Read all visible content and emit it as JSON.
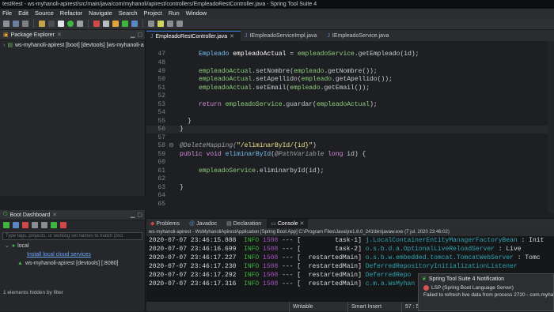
{
  "window_title": "testRest - ws-myhanoli-apirest/src/main/java/com/myhanoli/apirest/controllers/EmpleadoRestController.java - Spring Tool Suite 4",
  "menu": [
    "File",
    "Edit",
    "Source",
    "Refactor",
    "Navigate",
    "Search",
    "Project",
    "Run",
    "Window"
  ],
  "package_explorer": {
    "title": "Package Explorer",
    "project": "ws-myhanoli-apirest [boot] [devtools] [ws-myhanoli-a"
  },
  "boot_dashboard": {
    "title": "Boot Dashboard",
    "search_placeholder": "Type tags, projects, or working set names to match (incl",
    "group": "local",
    "link": "Install local cloud services",
    "app": "ws-myhanoli-apirest [devtools] [:8080]",
    "footer": "1 elements hidden by filter"
  },
  "editor_tabs": [
    "EmpleadoRestController.java",
    "IEmpleadoServiceImpl.java",
    "IEmpleadoService.java"
  ],
  "editor": {
    "line_numbers": [
      "47",
      "48",
      "49",
      "50",
      "51",
      "52",
      "53",
      "54",
      "55",
      "56",
      "57",
      "58",
      "59",
      "60",
      "61",
      "62",
      "63",
      "64",
      "65"
    ],
    "l47": {
      "a": "Empleado ",
      "b": "empleadoActual",
      "c": " = ",
      "d": "empleadoService",
      "e": ".getEmpleado(id);"
    },
    "l49": {
      "a": "empleadoActual",
      "b": ".setNombre(",
      "c": "empleado",
      "d": ".getNombre());"
    },
    "l50": {
      "a": "empleadoActual",
      "b": ".setApellido(",
      "c": "empleado",
      "d": ".getApellido());"
    },
    "l51": {
      "a": "empleadoActual",
      "b": ".setEmail(",
      "c": "empleado",
      "d": ".getEmail());"
    },
    "l53": {
      "a": "return ",
      "b": "empleadoService",
      "c": ".guardar(",
      "d": "empleadoActual",
      "e": ");"
    },
    "l55": "}",
    "l56": "}",
    "l58": {
      "a": "@DeleteMapping(",
      "b": "\"/eliminarById/{id}\"",
      "c": ")"
    },
    "l59": {
      "a": "public void ",
      "b": "eliminarById",
      "c": "(",
      "d": "@PathVariable ",
      "e": "long ",
      "f": "id) {"
    },
    "l61": {
      "a": "empleadoService",
      "b": ".eliminarbyId(id);"
    },
    "l63": "}"
  },
  "console_tabs": [
    "Problems",
    "Javadoc",
    "Declaration",
    "Console"
  ],
  "console_path": "ws-myhanoli-apirest - WsMyhanoliApirestApplication [Spring Boot App] C:\\Program Files\\Java\\jre1.8.0_241\\bin\\javaw.exe (7 jul. 2020 23:46:02)",
  "console_lines": [
    {
      "time": "2020-07-07 23:46:15.888",
      "level": "INFO",
      "pid": "1508",
      "sep": "--- [",
      "thread": "         task-1]",
      "cls": "j.LocalContainerEntityManagerFactoryBean",
      "msg": ": Init"
    },
    {
      "time": "2020-07-07 23:46:16.699",
      "level": "INFO",
      "pid": "1508",
      "sep": "--- [",
      "thread": "         task-2]",
      "cls": "o.s.b.d.a.OptionalLiveReloadServer",
      "msg": ": Live"
    },
    {
      "time": "2020-07-07 23:46:17.227",
      "level": "INFO",
      "pid": "1508",
      "sep": "--- [",
      "thread": "  restartedMain]",
      "cls": "o.s.b.w.embedded.tomcat.TomcatWebServer",
      "msg": ": Tomc"
    },
    {
      "time": "2020-07-07 23:46:17.230",
      "level": "INFO",
      "pid": "1508",
      "sep": "--- [",
      "thread": "  restartedMain]",
      "cls": "DeferredRepositoryInitializationListener",
      "msg": ""
    },
    {
      "time": "2020-07-07 23:46:17.292",
      "level": "INFO",
      "pid": "1508",
      "sep": "--- [",
      "thread": "  restartedMain]",
      "cls": "DeferredRepo",
      "msg": ""
    },
    {
      "time": "2020-07-07 23:46:17.316",
      "level": "INFO",
      "pid": "1508",
      "sep": "--- [",
      "thread": "  restartedMain]",
      "cls": "c.m.a.WsMyhan",
      "msg": ""
    }
  ],
  "status": {
    "mode": "Writable",
    "insert": "Smart Insert",
    "pos": "57 : 5"
  },
  "notification": {
    "title": "Spring Tool Suite 4 Notification",
    "server": "LSP (Spring Boot Language Server)",
    "message": "Failed to refresh live data from process 2720 - com.myhan"
  },
  "colors": {
    "accent": "#3d7dd8",
    "info": "#3fb43f",
    "pid": "#a655c2",
    "class": "#2fa5b3",
    "error_dot": "#d9534f"
  }
}
